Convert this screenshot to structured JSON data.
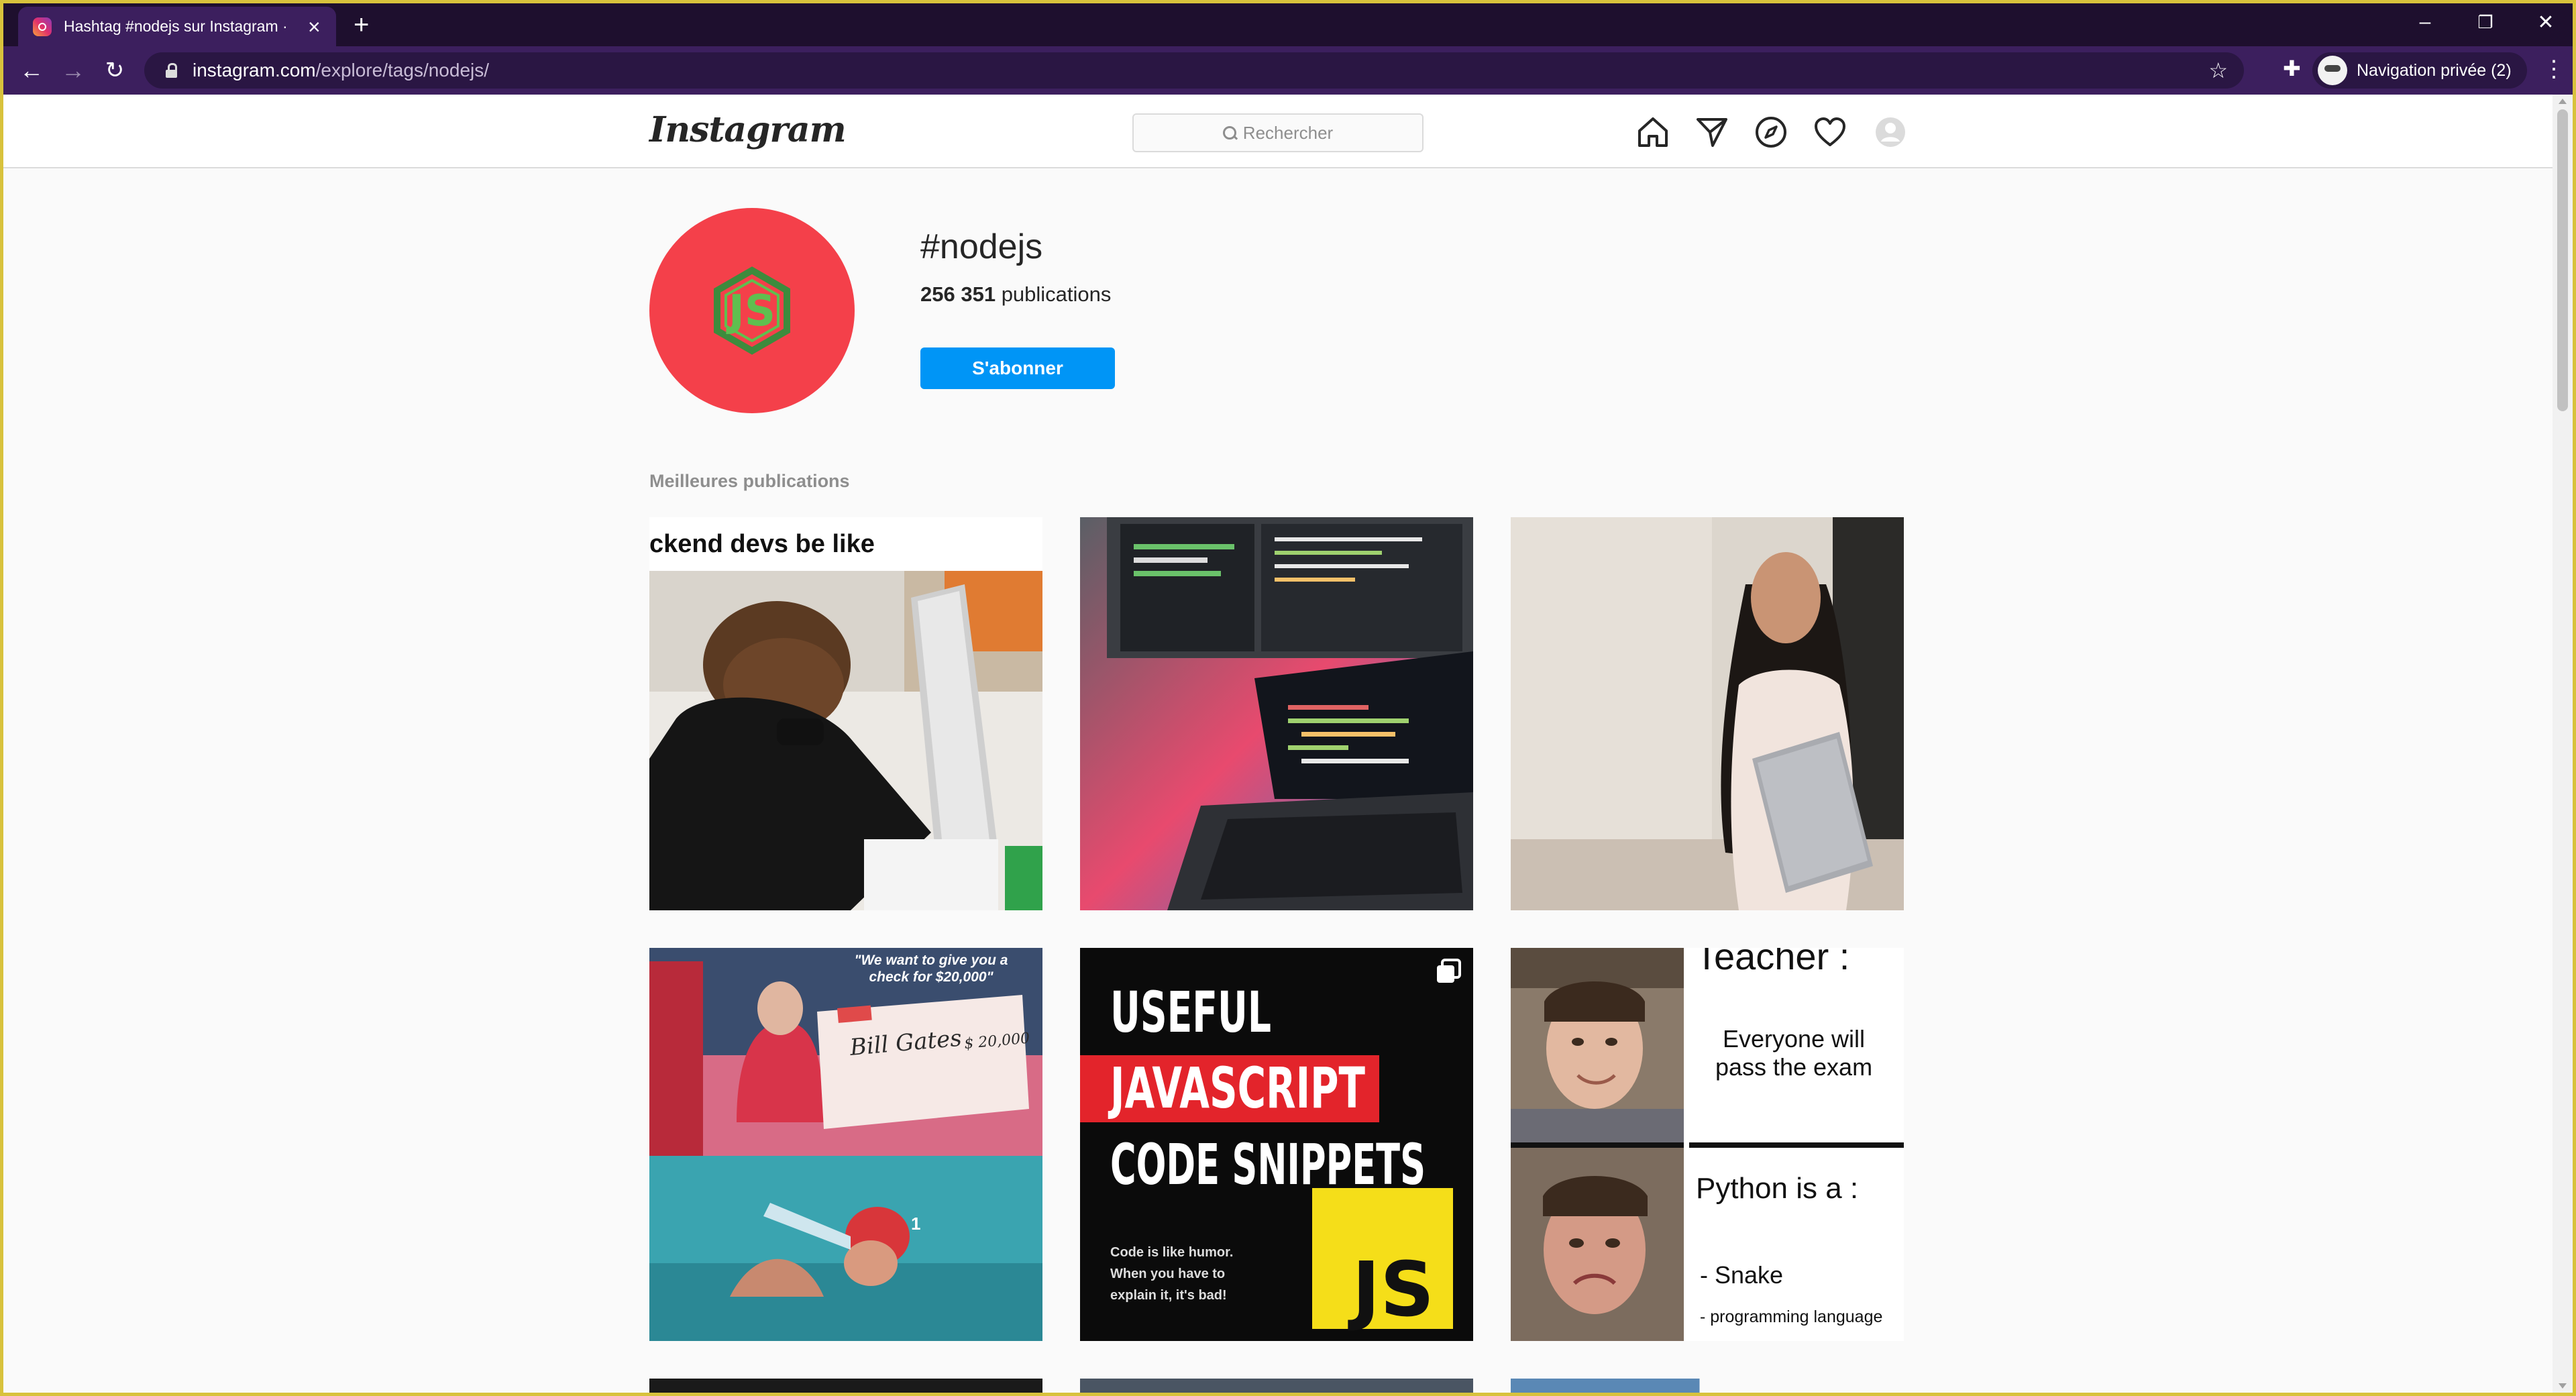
{
  "browser": {
    "tab_title": "Hashtag #nodejs sur Instagram ·",
    "url_host": "instagram.com",
    "url_path": "/explore/tags/nodejs/",
    "profile_label": "Navigation privée (2)"
  },
  "ig": {
    "logo": "Instagram",
    "search_placeholder": "Rechercher"
  },
  "hashtag": {
    "name": "#nodejs",
    "count": "256 351",
    "count_suffix": "publications",
    "follow_label": "S'abonner",
    "top_posts_label": "Meilleures publications",
    "avatar_text": "JS"
  },
  "posts": {
    "p1": {
      "caption": "ckend devs be like"
    },
    "p4": {
      "quote_line1": "\"We want to give you a",
      "quote_line2": "check for $20,000\"",
      "check_name": "Bill Gates",
      "check_amount": "$ 20,000",
      "cap_number": "1"
    },
    "p5": {
      "line1": "USEFUL",
      "line2": "JAVASCRIPT",
      "line3": "CODE SNIPPETS",
      "small1": "Code is like humor.",
      "small2": "When you have to",
      "small3": "explain it, it's bad!",
      "badge": "JS"
    },
    "p6": {
      "teacher": "Teacher :",
      "teacher_text1": "Everyone will",
      "teacher_text2": "pass the exam",
      "python": "Python is a :",
      "snake": "- Snake",
      "lang": "- programming language"
    }
  },
  "colors": {
    "accent": "#0095f6",
    "hashtag_avatar": "#f4404a",
    "browser_purple": "#3c1f5e"
  }
}
